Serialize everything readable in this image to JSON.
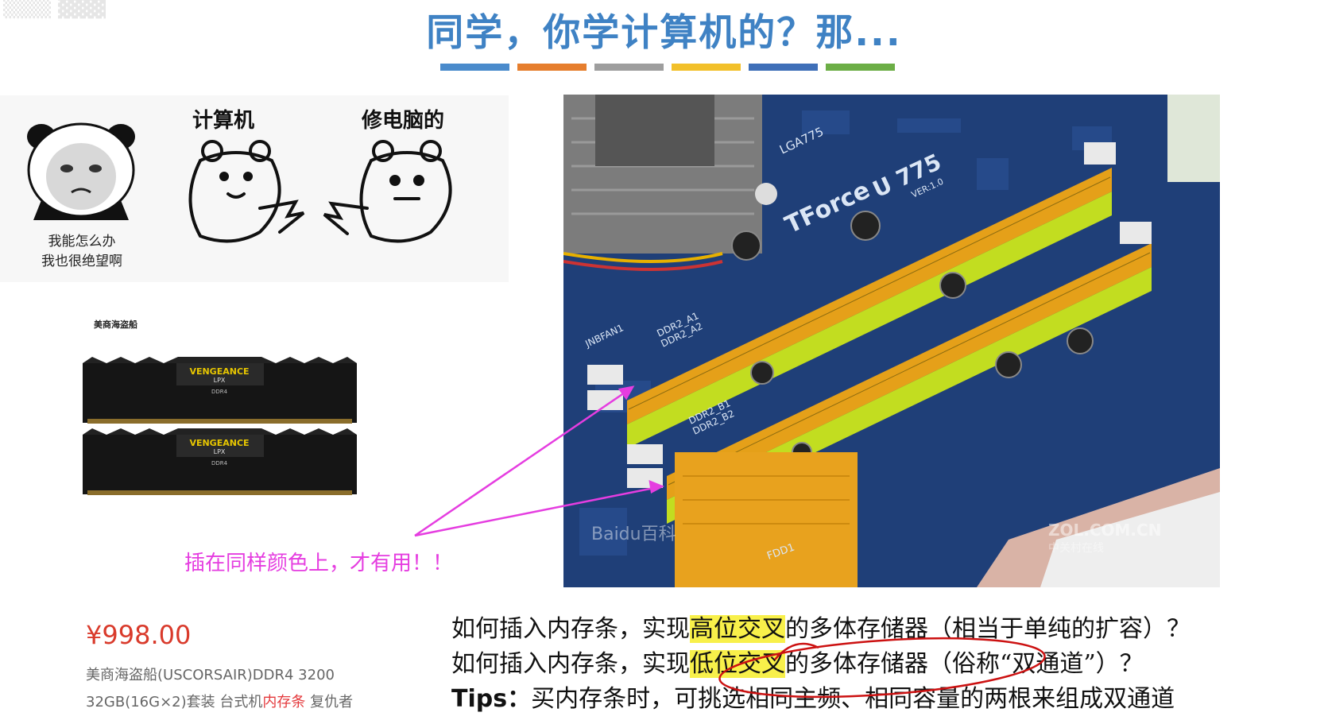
{
  "slide": {
    "title": "同学，你学计算机的？那...",
    "accent_colors": [
      "#4a8bcc",
      "#e67e2e",
      "#9e9e9e",
      "#f2c02a",
      "#3f6fb8",
      "#6cae46"
    ]
  },
  "meme": {
    "caption_line1": "我能怎么办",
    "caption_line2": "我也很绝望啊",
    "label_left": "计算机",
    "label_right": "修电脑的"
  },
  "product": {
    "brand_logo": "美商海盗船",
    "module_label": "VENGEANCE",
    "module_sublabel": "LPX",
    "module_type": "DDR4",
    "price": "¥998.00",
    "desc_line1": "美商海盗船(USCORSAIR)DDR4 3200",
    "desc_line2_a": "32GB(16G×2)套装 台式机",
    "desc_line2_b": "内存条",
    "desc_line2_c": " 复仇者"
  },
  "annotation": {
    "text": "插在同样颜色上，才有用！！"
  },
  "photo": {
    "cpu_socket": "LGA775",
    "board_brand": "TForce",
    "board_model": "U 775",
    "board_ver": "VER:1.0",
    "slot_a1": "DDR2_A1",
    "slot_a2": "DDR2_A2",
    "slot_b1": "DDR2_B1",
    "slot_b2": "DDR2_B2",
    "fan_label": "JNBFAN1",
    "fdd_label": "FDD1",
    "watermark_left": "Baidu百科",
    "watermark_right": "ZOL.COM.CN",
    "watermark_right_sub": "中关村在线"
  },
  "bottom": {
    "q1_pre": "如何插入内存条，实现",
    "q1_hl": "高位交叉",
    "q1_post": "的多体存储器（相当于单纯的扩容）？",
    "q2_pre": "如何插入内存条，实现",
    "q2_hl": "低位交叉",
    "q2_post": "的多体存储器（俗称“双通道”）？",
    "tips_label": "Tips：",
    "tips_text": "买内存条时，可挑选相同主频、相同容量的两根来组成双通道"
  },
  "colors": {
    "title": "#3f82c4",
    "annotation": "#e53de0",
    "price": "#d93a2b",
    "highlight": "#f8f04a",
    "slot_orange": "#e8a21e",
    "slot_green": "#c6e022",
    "pcb": "#1f3f78"
  }
}
